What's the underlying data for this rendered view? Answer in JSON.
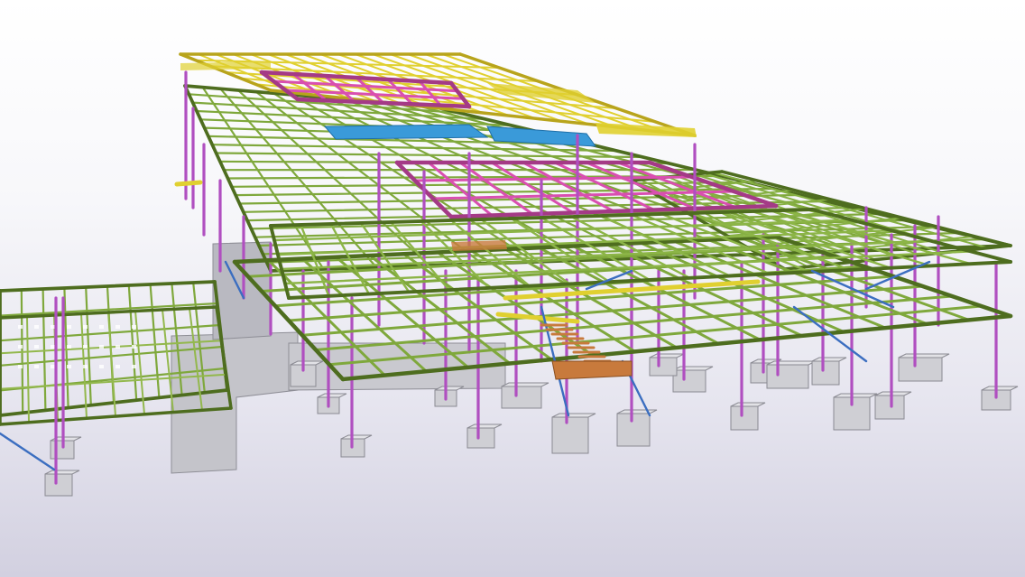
{
  "scene": {
    "background_top": "#ffffff",
    "background_bottom": "#d2d0e0",
    "member_colors": {
      "beams": "#7fa83c",
      "beam_edges": "#4e6d1f",
      "columns": "#b04fc0",
      "roof_purlins": "#e0d030",
      "roof_trusses": "#d94fb0",
      "panels": "#3a9ad9",
      "bracing": "#3b6ec0",
      "stairs": "#c87a3c",
      "footings": "#cfcfd4",
      "concrete_wall": "#c4c4ca"
    }
  }
}
